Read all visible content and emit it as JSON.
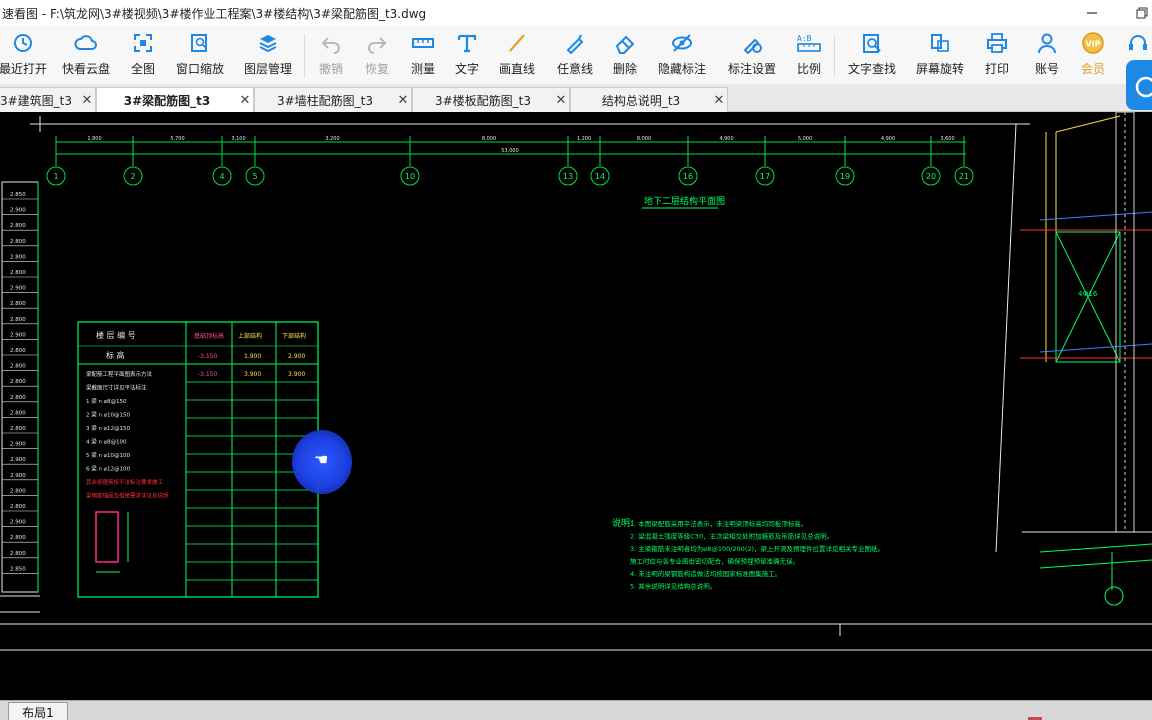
{
  "titlebar": {
    "title": "速看图 - F:\\筑龙网\\3#楼视频\\3#楼作业工程案\\3#楼结构\\3#梁配筋图_t3.dwg"
  },
  "toolbar": {
    "items": [
      {
        "label": "最近打开",
        "icon": "history-icon",
        "color": "#1e88e5"
      },
      {
        "label": "快看云盘",
        "icon": "cloud-icon",
        "color": "#1e88e5"
      },
      {
        "label": "全图",
        "icon": "fullscreen-icon",
        "color": "#1e88e5"
      },
      {
        "label": "窗口缩放",
        "icon": "zoom-window-icon",
        "color": "#1e88e5"
      },
      {
        "label": "图层管理",
        "icon": "layers-icon",
        "color": "#1e88e5"
      },
      {
        "label": "撤销",
        "icon": "undo-icon",
        "color": "#b9b9b9"
      },
      {
        "label": "恢复",
        "icon": "redo-icon",
        "color": "#b9b9b9"
      },
      {
        "label": "测量",
        "icon": "measure-icon",
        "color": "#1e88e5"
      },
      {
        "label": "文字",
        "icon": "text-icon",
        "color": "#1e88e5"
      },
      {
        "label": "画直线",
        "icon": "line-icon",
        "color": "#e0a02a"
      },
      {
        "label": "任意线",
        "icon": "pen-icon",
        "color": "#1e88e5"
      },
      {
        "label": "删除",
        "icon": "eraser-icon",
        "color": "#1e88e5"
      },
      {
        "label": "隐藏标注",
        "icon": "eye-off-icon",
        "color": "#1e88e5"
      },
      {
        "label": "标注设置",
        "icon": "annotation-settings-icon",
        "color": "#1e88e5"
      },
      {
        "label": "比例",
        "icon": "scale-icon",
        "color": "#1e88e5"
      },
      {
        "label": "文字查找",
        "icon": "text-search-icon",
        "color": "#1e88e5"
      },
      {
        "label": "屏幕旋转",
        "icon": "rotate-screen-icon",
        "color": "#1e88e5"
      },
      {
        "label": "打印",
        "icon": "print-icon",
        "color": "#1e88e5"
      },
      {
        "label": "账号",
        "icon": "account-icon",
        "color": "#1e88e5"
      },
      {
        "label": "会员",
        "icon": "vip-icon",
        "color": "#e0a02a"
      }
    ]
  },
  "tabs": [
    {
      "label": "3#建筑图_t3"
    },
    {
      "label": "3#梁配筋图_t3"
    },
    {
      "label": "3#墙柱配筋图_t3"
    },
    {
      "label": "3#楼板配筋图_t3"
    },
    {
      "label": "结构总说明_t3"
    }
  ],
  "drawing": {
    "axis_labels": [
      "1",
      "2",
      "4",
      "5",
      "10",
      "13",
      "14",
      "16",
      "17",
      "19",
      "20",
      "21"
    ],
    "dim_labels": [
      "1,800",
      "5,700",
      "3,100",
      "3,200",
      "8,000",
      "1,200",
      "8,000",
      "4,900",
      "5,000",
      "4,900",
      "3,600",
      "3,700"
    ],
    "overall_dim": "53,000",
    "plan_title": "地下二层结构平面图",
    "elev_labels": [
      "2.850",
      "2.900",
      "2.800",
      "2.800",
      "2.800",
      "2.800",
      "2.900",
      "2.800",
      "2.800",
      "2.900",
      "2.800",
      "2.800",
      "2.800",
      "2.800",
      "2.800",
      "2.800",
      "2.900",
      "2.900",
      "2.900",
      "2.800",
      "2.800",
      "2.900",
      "2.800",
      "2.800",
      "2.850"
    ],
    "table": {
      "header_a": "楼 层 编 号",
      "header_b": "标 高",
      "col1": "基础顶标高",
      "col2": "上部结构",
      "col3": "下部结构",
      "row1": [
        "-3.150",
        "1.900",
        "2.900"
      ],
      "row2": [
        "-3.150",
        "3.900",
        "3.900"
      ],
      "note_lines": [
        "梁配筋工程平面图表示方法",
        "梁截面尺寸详见平法标注",
        "1 梁 n ⌀8@150",
        "2 梁 n ⌀10@150",
        "3 梁 n ⌀12@150",
        "4 梁 n ⌀8@100",
        "5 梁 n ⌀10@100",
        "6 梁 n ⌀12@100",
        "其余梁箍筋按平法标注要求施工",
        "梁钢筋锚固及搭接要求详见总说明"
      ]
    },
    "notes_title": "说明：",
    "notes": [
      "1. 本图梁配筋采用平法表示，未注明梁顶标高均同板顶标高。",
      "2. 梁混凝土强度等级C30，主次梁相交处附加箍筋及吊筋详见总说明。",
      "3. 主梁箍筋未注明者均为⌀8@100/200(2)，梁上开洞及预埋件位置详见相关专业图纸。",
      "   施工时应与各专业图纸密切配合，确保预埋预留准确无误。",
      "4. 未注明的梁钢筋构造做法均按国家标准图集施工。",
      "5. 其余说明详见结构总说明。"
    ],
    "right_label": "4Ф16"
  },
  "statusbar": {
    "layout_tab": "布局1"
  }
}
